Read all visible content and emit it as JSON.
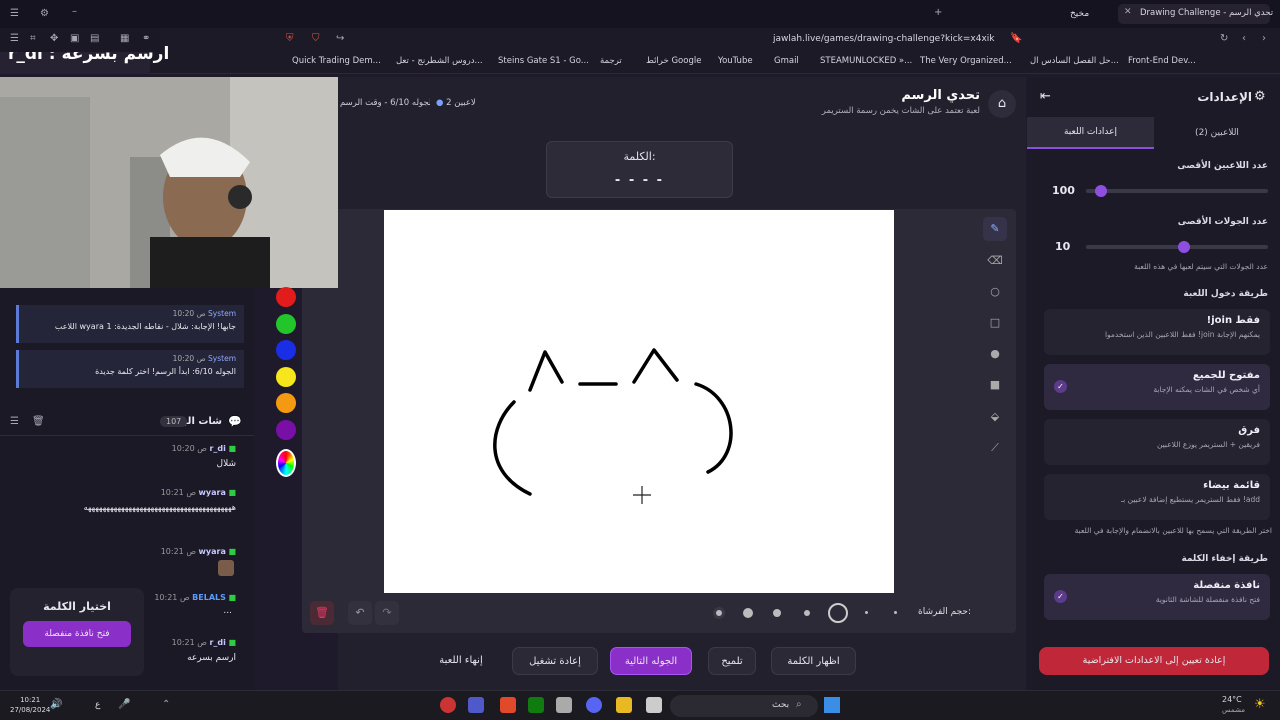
{
  "browser": {
    "active_tab": "Drawing Challenge - تحدي الرسم",
    "other_tab": "مخيخ",
    "url": "jawlah.live/games/drawing-challenge?kick=x4xik",
    "bookmarks": [
      "Front-End Dev...",
      "حل الفصل السادس ال...",
      "The Very Organized...",
      "STEAMUNLOCKED »...",
      "Gmail",
      "YouTube",
      "خرائط Google",
      "ترجمة",
      "Steins Gate S1 - Go...",
      "دروس الشطرنج - تعل...",
      "Quick Trading Dem..."
    ]
  },
  "stream_overlay": {
    "title": "r_di : ارسم بسرعه"
  },
  "header": {
    "title": "تحدي الرسم",
    "subtitle": "لعبة تعتمد على الشات يخمن رسمة الستريمر",
    "players": "2 لاعبين",
    "round": "الجوله 6/10 - وقت الرسم"
  },
  "word_box": {
    "label": "الكلمة:",
    "hint": "- - - -"
  },
  "colors": [
    "#e21b1b",
    "#22c52a",
    "#1a2ee6",
    "#f6e61b",
    "#f49a12",
    "#7a0fa8"
  ],
  "drawing_tools": [
    "pencil-icon",
    "eraser-icon",
    "circle-icon",
    "square-icon",
    "filled-circle-icon",
    "filled-square-icon",
    "fill-icon",
    "line-icon"
  ],
  "brush": {
    "label": "حجم الفرشاة:"
  },
  "actions": {
    "end_game": "إنهاء اللعبة",
    "restart": "إعادة تشغيل",
    "next_round": "الجوله التالية",
    "hint": "تلميح",
    "reveal": "اظهار الكلمة"
  },
  "system_messages": [
    {
      "author": "System",
      "time": "10:20 ص",
      "text": "اللاعب wyara جابها! الإجابة: شلال - نقاطه الجديدة: 1"
    },
    {
      "author": "System",
      "time": "10:20 ص",
      "text": "الجوله 6/10: ابدأ الرسم! اختر كلمة جديدة"
    }
  ],
  "chat": {
    "title": "شات البث",
    "count": "107",
    "messages": [
      {
        "user": "r_di",
        "time": "10:20 ص",
        "text": "شلال"
      },
      {
        "user": "wyara",
        "time": "10:21 ص",
        "text": "ههههههههههههههههههههههههههههههههههههههههه"
      },
      {
        "user": "wyara",
        "time": "10:21 ص",
        "text": ""
      },
      {
        "user": "BELALS",
        "time": "10:21 ص",
        "text": "..."
      },
      {
        "user": "r_di",
        "time": "10:21 ص",
        "text": "ارسم بسرعه"
      }
    ]
  },
  "word_picker": {
    "title": "اختيار الكلمة",
    "button": "فتح نافذة منفصلة"
  },
  "settings": {
    "title": "الإعدادات",
    "tabs": [
      "إعدادات اللعبة",
      "اللاعبين (2)"
    ],
    "max_players_label": "عدد اللاعبين الأقصى",
    "max_players": "100",
    "max_rounds_label": "عدد الجولات الأقصى",
    "max_rounds": "10",
    "max_rounds_fraction": 0.54,
    "max_players_fraction": 0.05,
    "rounds_help": "عدد الجولات التي سيتم لعبها في هذه اللعبة",
    "entry_label": "طريقة دخول اللعبة",
    "entry_options": [
      {
        "title": "!join فقط",
        "desc": "فقط اللاعبين الذين استخدموا !join يمكنهم الإجابة"
      },
      {
        "title": "مفتوح للجميع",
        "desc": "أي شخص في الشات يمكنه الإجابة"
      },
      {
        "title": "فرق",
        "desc": "فريقين + الستريمر يوزع اللاعبين"
      },
      {
        "title": "قائمة بيضاء",
        "desc": "فقط الستريمر يستطيع إضافة لاعبين بـ !add"
      }
    ],
    "entry_help": "اختر الطريقة التي يسمح بها للاعبين بالانضمام والإجابة في اللعبة",
    "hide_label": "طريقة إخفاء الكلمة",
    "hide_option": {
      "title": "نافذة منفصلة",
      "desc": "فتح نافذة منفصلة للشاشة الثانوية"
    },
    "reset": "إعادة تعيين إلى الاعدادات الافتراضية"
  },
  "taskbar": {
    "temp": "24°C",
    "weather": "مشمس",
    "search": "بحث",
    "time": "10:21",
    "date": "27/08/2024",
    "lang": "ع"
  }
}
